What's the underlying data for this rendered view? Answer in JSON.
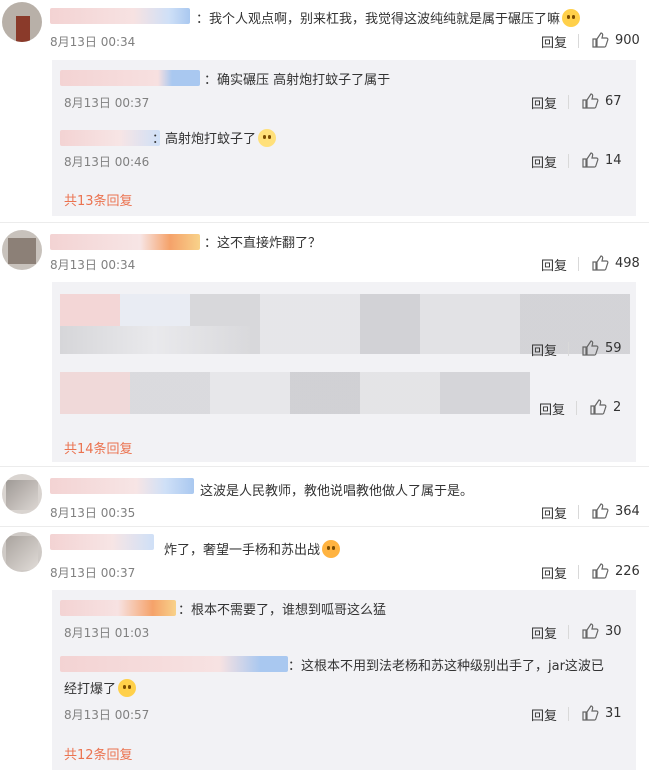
{
  "comments": [
    {
      "text": "：我个人观点啊，别来杠我，我觉得这波纯纯就是属于碾压了嘛",
      "time": "8月13日 00:34",
      "reply_label": "回复",
      "likes": "900",
      "replies": [
        {
          "text": "：确实碾压 高射炮打蚊子了属于",
          "time": "8月13日 00:37",
          "reply_label": "回复",
          "likes": "67"
        },
        {
          "text": "：高射炮打蚊子了",
          "time": "8月13日 00:46",
          "reply_label": "回复",
          "likes": "14"
        }
      ],
      "more": "共13条回复"
    },
    {
      "text": "：这不直接炸翻了？",
      "time": "8月13日 00:34",
      "reply_label": "回复",
      "likes": "498",
      "replies": [
        {
          "reply_label": "回复",
          "likes": "59"
        },
        {
          "reply_label": "回复",
          "likes": "2"
        }
      ],
      "more": "共14条回复"
    },
    {
      "text": "这波是人民教师，教他说唱教他做人了属于是。",
      "time": "8月13日 00:35",
      "reply_label": "回复",
      "likes": "364"
    },
    {
      "text": "炸了，奢望一手杨和苏出战",
      "time": "8月13日 00:37",
      "reply_label": "回复",
      "likes": "226",
      "replies": [
        {
          "text": "：根本不需要了，谁想到呱哥这么猛",
          "time": "8月13日 01:03",
          "reply_label": "回复",
          "likes": "30"
        },
        {
          "text": "：这根本不用到法老杨和苏这种级别出手了，jar这波已",
          "text2": "经打爆了",
          "time": "8月13日 00:57",
          "reply_label": "回复",
          "likes": "31"
        }
      ],
      "more": "共12条回复"
    }
  ],
  "icons": {
    "like": "thumbs-up-icon",
    "emoji": "emoji-icon"
  }
}
